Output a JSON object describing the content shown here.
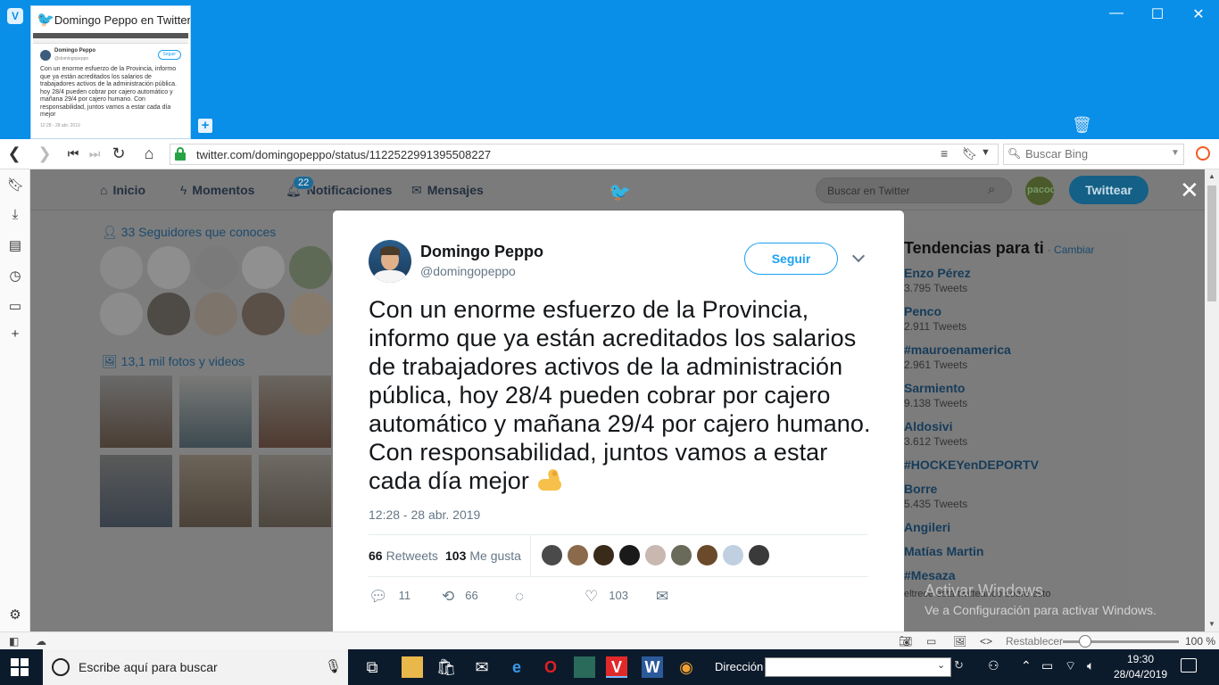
{
  "browser": {
    "tab_title": "Domingo Peppo en Twitter:",
    "url": "twitter.com/domingopeppo/status/1122522991395508227",
    "search_placeholder": "Buscar Bing",
    "thumb": {
      "name": "Domingo Peppo",
      "handle": "@domingopeppo",
      "follow": "Seguir",
      "text": "Con un enorme esfuerzo de la Provincia, informo que ya están acreditados los salarios de trabajadores activos de la administración pública. hoy 28/4 pueden cobrar por cajero automático y mañana 29/4 por cajero humano. Con responsabilidad, juntos vamos a estar cada día mejor",
      "date": "12:28 - 28 abr. 2019"
    }
  },
  "twitter_nav": {
    "home": "Inicio",
    "moments": "Momentos",
    "notifications": "Notificaciones",
    "notifications_badge": "22",
    "messages": "Mensajes",
    "search_placeholder": "Buscar en Twitter",
    "tweet_button": "Twittear"
  },
  "left_column": {
    "followers_title": "33 Seguidores que conoces",
    "photos_title": "13,1 mil fotos y videos"
  },
  "trends": {
    "title": "Tendencias para ti",
    "change": "· Cambiar",
    "items": [
      {
        "name": "Enzo Pérez",
        "count": "3.795 Tweets"
      },
      {
        "name": "Penco",
        "count": "2.911 Tweets"
      },
      {
        "name": "#mauroenamerica",
        "count": "2.961 Tweets"
      },
      {
        "name": "Sarmiento",
        "count": "9.138 Tweets"
      },
      {
        "name": "Aldosivi",
        "count": "3.612 Tweets"
      },
      {
        "name": "#HOCKEYenDEPORTV",
        "count": ""
      },
      {
        "name": "Borre",
        "count": "5.435 Tweets"
      },
      {
        "name": "Angileri",
        "count": ""
      },
      {
        "name": "Matías Martin",
        "count": ""
      },
      {
        "name": "#Mesaza",
        "count": ""
      }
    ],
    "mesaza_sub": "eltrece está twitteando sobre esto"
  },
  "windows_watermark": {
    "line1": "Activar Windows",
    "line2": "Ve a Configuración para activar Windows."
  },
  "tweet": {
    "name": "Domingo Peppo",
    "handle": "@domingopeppo",
    "follow": "Seguir",
    "text": "Con un enorme esfuerzo de la Provincia, informo que ya están acreditados los salarios de trabajadores activos de la administración pública, hoy 28/4 pueden cobrar por cajero automático y mañana 29/4 por cajero humano. Con responsabilidad, juntos vamos a estar cada día mejor",
    "emoji": "flexed-biceps-emoji",
    "time": "12:28 - 28 abr. 2019",
    "retweets_count": "66",
    "retweets_label": "Retweets",
    "likes_count": "103",
    "likes_label": "Me gusta",
    "actions": {
      "replies": "11",
      "retweets": "66",
      "likes": "103"
    }
  },
  "statusbar": {
    "reset": "Restablecer",
    "zoom": "100 %",
    "zoom_fraction": 0.14
  },
  "taskbar": {
    "search_placeholder": "Escribe aquí para buscar",
    "address_label": "Dirección",
    "time": "19:30",
    "date": "28/04/2019"
  },
  "colors": {
    "accent": "#1da1f2",
    "vivaldi": "#0a8fe8",
    "overlay": "#7d7d7d",
    "taskbar": "#0c1b2c"
  }
}
